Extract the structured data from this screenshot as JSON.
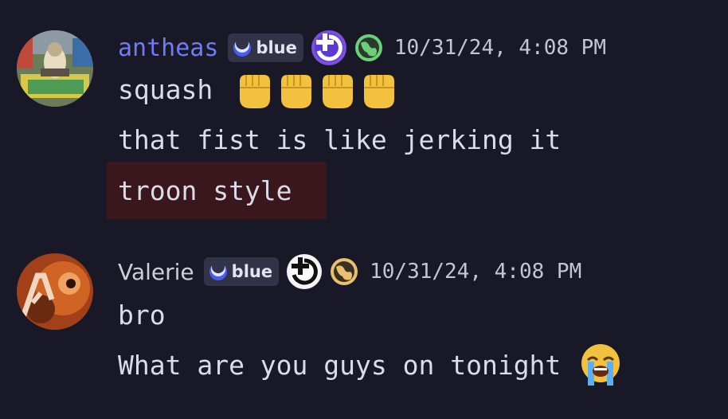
{
  "messages": [
    {
      "username": "antheas",
      "username_color": "#6e7cf5",
      "badge_label": "blue",
      "timestamp": "10/31/24, 4:08 PM",
      "lines": [
        {
          "text": "squash",
          "emoji": [
            "raised-fist",
            "raised-fist",
            "raised-fist",
            "raised-fist"
          ]
        },
        {
          "text": "that fist is like jerking it"
        },
        {
          "text": "troon style",
          "highlighted": true
        }
      ]
    },
    {
      "username": "Valerie",
      "username_color": "#cfcfd8",
      "badge_label": "blue",
      "timestamp": "10/31/24, 4:08 PM",
      "lines": [
        {
          "text": "bro"
        },
        {
          "text": "What are you guys on tonight",
          "emoji": [
            "loudly-crying-face"
          ]
        }
      ]
    }
  ],
  "colors": {
    "background": "#181826",
    "highlight_bg": "#3a161d",
    "badge_bg": "#313349",
    "role_purple": "#7b4fe0",
    "globe_green": "#6ccf7a",
    "globe_gold": "#e8c070"
  }
}
